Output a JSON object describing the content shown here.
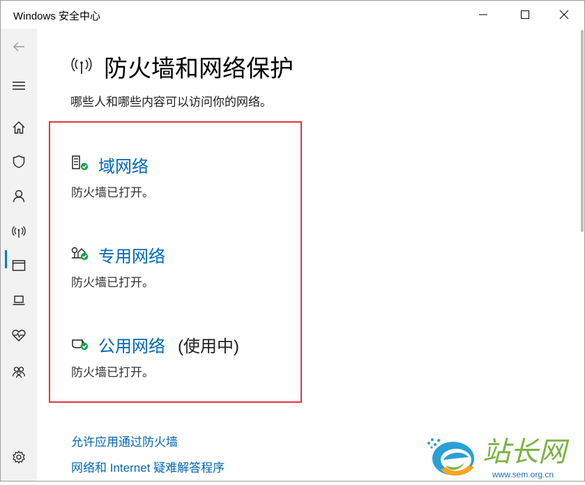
{
  "window": {
    "title": "Windows 安全中心"
  },
  "page": {
    "title": "防火墙和网络保护",
    "subtitle": "哪些人和哪些内容可以访问你的网络。"
  },
  "networks": [
    {
      "name": "域网络",
      "suffix": "",
      "status": "防火墙已打开。",
      "icon": "domain-network-icon"
    },
    {
      "name": "专用网络",
      "suffix": "",
      "status": "防火墙已打开。",
      "icon": "private-network-icon"
    },
    {
      "name": "公用网络",
      "suffix": "(使用中)",
      "status": "防火墙已打开。",
      "icon": "public-network-icon"
    }
  ],
  "links": {
    "allow_app": "允许应用通过防火墙",
    "troubleshoot": "网络和 Internet 疑难解答程序"
  },
  "watermark": {
    "site_name": "站长网",
    "url": "www.sem.org.cn"
  },
  "colors": {
    "accent": "#0067b8",
    "highlight": "#e2363c",
    "status_ok": "#16a34a"
  }
}
